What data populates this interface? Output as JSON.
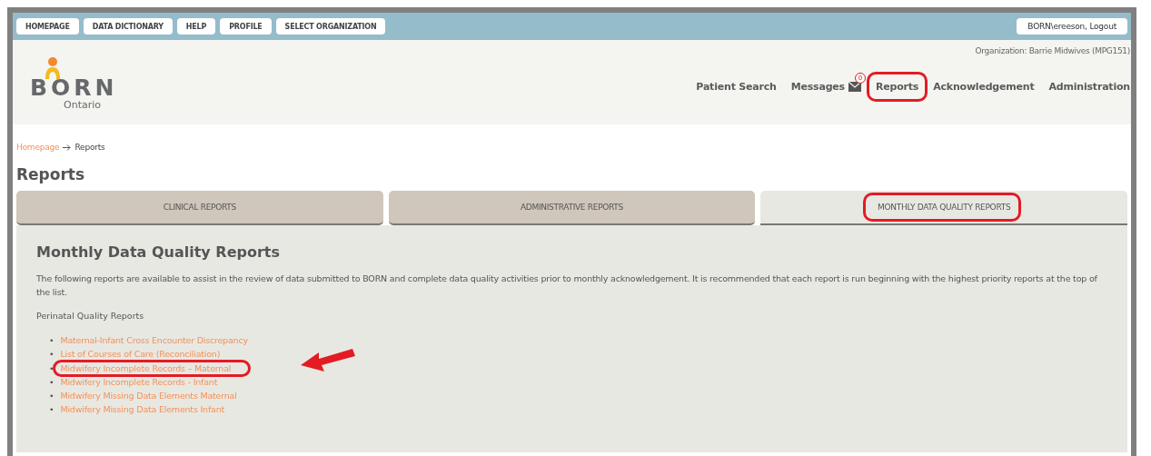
{
  "top_bar": {
    "buttons": [
      "HOMEPAGE",
      "DATA DICTIONARY",
      "HELP",
      "PROFILE",
      "SELECT ORGANIZATION"
    ],
    "user_button": "BORN\\ereeson, Logout"
  },
  "header": {
    "logo": {
      "name": "BORN",
      "sub": "Ontario"
    },
    "organization": "Organization: Barrie Midwives (MPG151)",
    "nav": [
      {
        "label": "Patient Search",
        "highlighted": false
      },
      {
        "label": "Messages",
        "badge": "0",
        "highlighted": false
      },
      {
        "label": "Reports",
        "highlighted": true
      },
      {
        "label": "Acknowledgement",
        "highlighted": false
      },
      {
        "label": "Administration",
        "highlighted": false
      }
    ]
  },
  "breadcrumb": [
    {
      "label": "Homepage",
      "kind": "link"
    },
    {
      "label": "Reports",
      "kind": "current"
    }
  ],
  "page_title": "Reports",
  "tabs": [
    {
      "label": "CLINICAL REPORTS",
      "selected": false,
      "highlighted": false
    },
    {
      "label": "ADMINISTRATIVE REPORTS",
      "selected": false,
      "highlighted": false
    },
    {
      "label": "MONTHLY DATA QUALITY REPORTS",
      "selected": true,
      "highlighted": true
    }
  ],
  "panel": {
    "title": "Monthly Data Quality Reports",
    "description": "The following reports are available to assist in the review of data submitted to BORN and complete data quality activities prior to monthly acknowledgement. It is recommended that each report is run beginning with the highest priority reports at the top of the list.",
    "section": "Perinatal Quality Reports",
    "bullet": "•",
    "reports": [
      {
        "label": "Maternal-Infant Cross Encounter Discrepancy",
        "highlighted": false,
        "arrow": false
      },
      {
        "label": "List of Courses of Care (Reconciliation)",
        "highlighted": false,
        "arrow": false
      },
      {
        "label": "Midwifery Incomplete Records – Maternal",
        "highlighted": true,
        "arrow": true
      },
      {
        "label": "Midwifery Incomplete Records - Infant",
        "highlighted": false,
        "arrow": false
      },
      {
        "label": "Midwifery Missing Data Elements Maternal",
        "highlighted": false,
        "arrow": false
      },
      {
        "label": "Midwifery Missing Data Elements Infant",
        "highlighted": false,
        "arrow": false
      }
    ]
  }
}
